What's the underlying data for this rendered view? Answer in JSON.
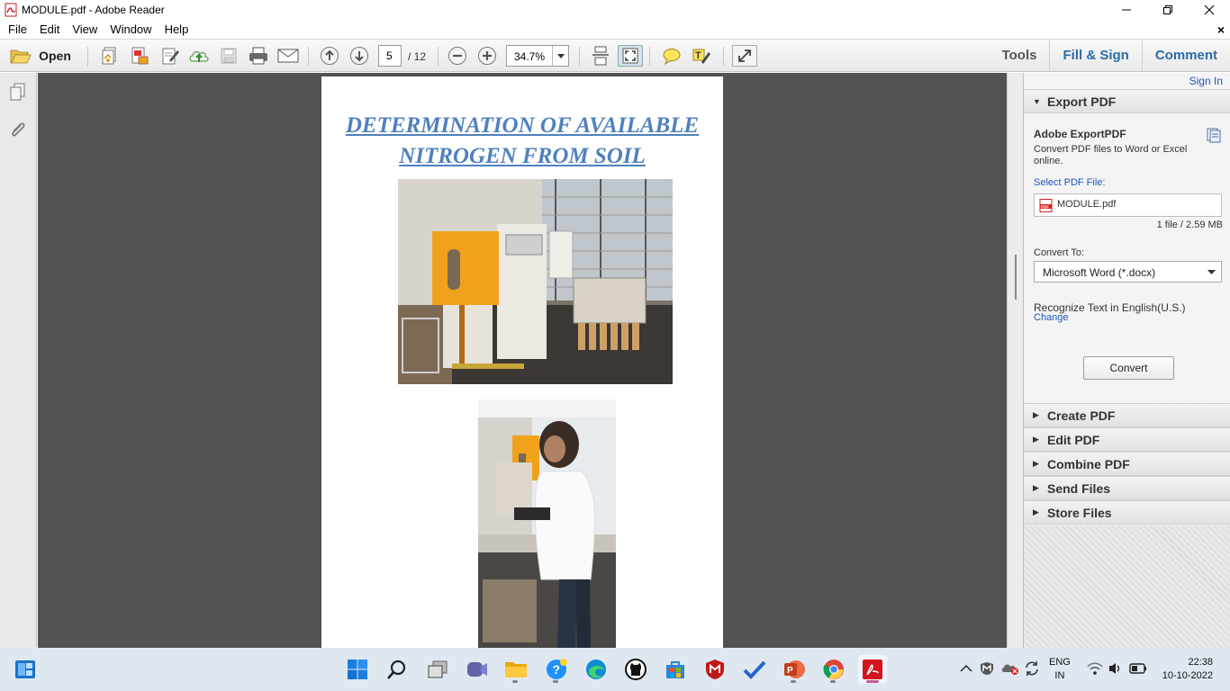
{
  "window": {
    "title": "MODULE.pdf - Adobe Reader"
  },
  "menu": {
    "items": [
      "File",
      "Edit",
      "View",
      "Window",
      "Help"
    ],
    "doc_close": "×"
  },
  "toolbar": {
    "open_label": "Open",
    "current_page": "5",
    "total_pages": "/ 12",
    "zoom": "34.7%",
    "tabs": [
      "Tools",
      "Fill & Sign",
      "Comment"
    ]
  },
  "document": {
    "title_line1": "DETERMINATION OF AVAILABLE",
    "title_line2": "NITROGEN FROM SOIL"
  },
  "right_panel": {
    "sign_in": "Sign In",
    "export_header": "Export PDF",
    "export_title": "Adobe ExportPDF",
    "export_desc": "Convert PDF files to Word or Excel online.",
    "select_label": "Select PDF File:",
    "file_name": "MODULE.pdf",
    "file_info": "1 file / 2.59 MB",
    "convert_to_label": "Convert To:",
    "convert_to_value": "Microsoft Word (*.docx)",
    "recognize_text": "Recognize Text in English(U.S.)",
    "change_link": "Change",
    "convert_button": "Convert",
    "sections": [
      "Create PDF",
      "Edit PDF",
      "Combine PDF",
      "Send Files",
      "Store Files"
    ]
  },
  "taskbar": {
    "lang_top": "ENG",
    "lang_bottom": "IN",
    "time": "22:38",
    "date": "10-10-2022"
  },
  "colors": {
    "accent": "#2c6aa8",
    "doc_title": "#4f81bd",
    "doc_background": "#525252"
  }
}
